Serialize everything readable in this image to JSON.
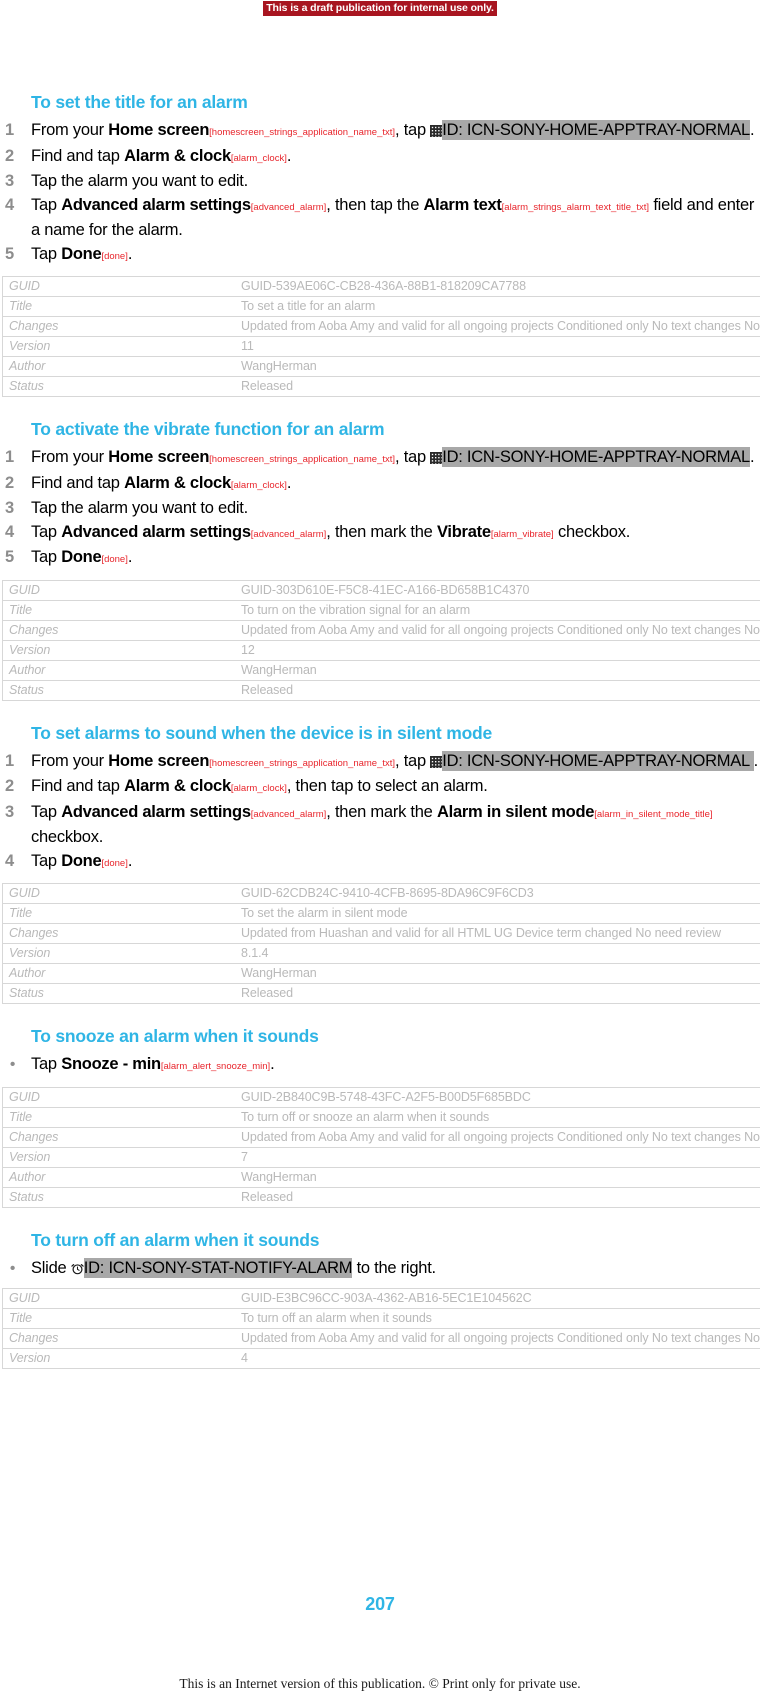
{
  "banner": {
    "draft_notice": "This is a draft publication for internal use only."
  },
  "colors": {
    "heading": "#2fb5e5",
    "string_id": "#e8252c",
    "highlight": "#a8a8a8",
    "banner_bg": "#a81520",
    "table_text": "#b9b9b9",
    "step_number": "#8d8d8d"
  },
  "table_labels": {
    "guid": "GUID",
    "title": "Title",
    "changes": "Changes",
    "version": "Version",
    "author": "Author",
    "status": "Status"
  },
  "icons": {
    "apptray": {
      "name": "app-tray-icon",
      "id_text": "ID: ICN-SONY-HOME-APPTRAY-NORMAL"
    },
    "alarm": {
      "name": "alarm-clock-icon",
      "id_text": "ID: ICN-SONY-STAT-NOTIFY-ALARM"
    }
  },
  "sections": [
    {
      "id": "set-title-for-alarm",
      "title": "To set the title for an alarm",
      "list_type": "ordered",
      "steps": [
        {
          "marker": "1",
          "parts": [
            {
              "t": "text",
              "v": "From your "
            },
            {
              "t": "bold",
              "v": "Home screen"
            },
            {
              "t": "sid",
              "v": "[homescreen_strings_application_name_txt]"
            },
            {
              "t": "text",
              "v": ", tap "
            },
            {
              "t": "icon",
              "v": "apptray"
            },
            {
              "t": "hl",
              "v": "ID: ICN-SONY-HOME-APPTRAY-NORMAL"
            },
            {
              "t": "text",
              "v": "."
            }
          ]
        },
        {
          "marker": "2",
          "parts": [
            {
              "t": "text",
              "v": "Find and tap "
            },
            {
              "t": "bold",
              "v": "Alarm & clock"
            },
            {
              "t": "sid",
              "v": "[alarm_clock]"
            },
            {
              "t": "text",
              "v": "."
            }
          ]
        },
        {
          "marker": "3",
          "parts": [
            {
              "t": "text",
              "v": "Tap the alarm you want to edit."
            }
          ]
        },
        {
          "marker": "4",
          "parts": [
            {
              "t": "text",
              "v": "Tap "
            },
            {
              "t": "bold",
              "v": "Advanced alarm settings"
            },
            {
              "t": "sid",
              "v": "[advanced_alarm]"
            },
            {
              "t": "text",
              "v": ", then tap the "
            },
            {
              "t": "bold",
              "v": "Alarm text"
            },
            {
              "t": "sid",
              "v": "[alarm_strings_alarm_text_title_txt]"
            },
            {
              "t": "text",
              "v": " field and enter a name for the alarm."
            }
          ]
        },
        {
          "marker": "5",
          "parts": [
            {
              "t": "text",
              "v": "Tap "
            },
            {
              "t": "bold",
              "v": "Done"
            },
            {
              "t": "sid",
              "v": "[done]"
            },
            {
              "t": "text",
              "v": "."
            }
          ]
        }
      ],
      "meta": {
        "guid": "GUID-539AE06C-CB28-436A-88B1-818209CA7788",
        "title": "To set a title for an alarm",
        "changes": "Updated from Aoba Amy and valid for all ongoing projects Conditioned only No text changes No need review",
        "version": "11",
        "author": "WangHerman",
        "status": "Released"
      }
    },
    {
      "id": "activate-vibrate-function",
      "title": "To activate the vibrate function for an alarm",
      "list_type": "ordered",
      "steps": [
        {
          "marker": "1",
          "parts": [
            {
              "t": "text",
              "v": "From your "
            },
            {
              "t": "bold",
              "v": "Home screen"
            },
            {
              "t": "sid",
              "v": "[homescreen_strings_application_name_txt]"
            },
            {
              "t": "text",
              "v": ", tap "
            },
            {
              "t": "icon",
              "v": "apptray"
            },
            {
              "t": "hl",
              "v": "ID: ICN-SONY-HOME-APPTRAY-NORMAL"
            },
            {
              "t": "text",
              "v": "."
            }
          ]
        },
        {
          "marker": "2",
          "parts": [
            {
              "t": "text",
              "v": "Find and tap "
            },
            {
              "t": "bold",
              "v": "Alarm & clock"
            },
            {
              "t": "sid",
              "v": "[alarm_clock]"
            },
            {
              "t": "text",
              "v": "."
            }
          ]
        },
        {
          "marker": "3",
          "parts": [
            {
              "t": "text",
              "v": "Tap the alarm you want to edit."
            }
          ]
        },
        {
          "marker": "4",
          "parts": [
            {
              "t": "text",
              "v": "Tap "
            },
            {
              "t": "bold",
              "v": "Advanced alarm settings"
            },
            {
              "t": "sid",
              "v": "[advanced_alarm]"
            },
            {
              "t": "text",
              "v": ", then mark the "
            },
            {
              "t": "bold",
              "v": "Vibrate"
            },
            {
              "t": "sid",
              "v": "[alarm_vibrate]"
            },
            {
              "t": "text",
              "v": " checkbox."
            }
          ]
        },
        {
          "marker": "5",
          "parts": [
            {
              "t": "text",
              "v": "Tap "
            },
            {
              "t": "bold",
              "v": "Done"
            },
            {
              "t": "sid",
              "v": "[done]"
            },
            {
              "t": "text",
              "v": "."
            }
          ]
        }
      ],
      "meta": {
        "guid": "GUID-303D610E-F5C8-41EC-A166-BD658B1C4370",
        "title": "To turn on the vibration signal for an alarm",
        "changes": "Updated from Aoba Amy and valid for all ongoing projects Conditioned only No text changes No need review",
        "version": "12",
        "author": "WangHerman",
        "status": "Released"
      }
    },
    {
      "id": "alarms-in-silent-mode",
      "title": "To set alarms to sound when the device is in silent mode",
      "list_type": "ordered",
      "steps": [
        {
          "marker": "1",
          "parts": [
            {
              "t": "text",
              "v": "From your "
            },
            {
              "t": "bold",
              "v": "Home screen"
            },
            {
              "t": "sid",
              "v": "[homescreen_strings_application_name_txt]"
            },
            {
              "t": "text",
              "v": ", tap "
            },
            {
              "t": "icon",
              "v": "apptray"
            },
            {
              "t": "hl",
              "v": "ID: ICN-SONY-HOME-APPTRAY-NORMAL "
            },
            {
              "t": "text",
              "v": "."
            }
          ]
        },
        {
          "marker": "2",
          "parts": [
            {
              "t": "text",
              "v": "Find and tap "
            },
            {
              "t": "bold",
              "v": "Alarm & clock"
            },
            {
              "t": "sid",
              "v": "[alarm_clock]"
            },
            {
              "t": "text",
              "v": ", then tap to select an alarm."
            }
          ]
        },
        {
          "marker": "3",
          "parts": [
            {
              "t": "text",
              "v": "Tap "
            },
            {
              "t": "bold",
              "v": "Advanced alarm settings"
            },
            {
              "t": "sid",
              "v": "[advanced_alarm]"
            },
            {
              "t": "text",
              "v": ", then mark the "
            },
            {
              "t": "bold",
              "v": "Alarm in silent mode"
            },
            {
              "t": "sid",
              "v": "[alarm_in_silent_mode_title]"
            },
            {
              "t": "text",
              "v": " checkbox."
            }
          ]
        },
        {
          "marker": "4",
          "parts": [
            {
              "t": "text",
              "v": "Tap "
            },
            {
              "t": "bold",
              "v": "Done"
            },
            {
              "t": "sid",
              "v": "[done]"
            },
            {
              "t": "text",
              "v": "."
            }
          ]
        }
      ],
      "meta": {
        "guid": "GUID-62CDB24C-9410-4CFB-8695-8DA96C9F6CD3",
        "title": "To set the alarm in silent mode",
        "changes": "Updated from Huashan and valid for all HTML UG Device term changed No need review",
        "version": "8.1.4",
        "author": "WangHerman",
        "status": "Released"
      }
    },
    {
      "id": "snooze-alarm",
      "title": "To snooze an alarm when it sounds",
      "list_type": "bullet",
      "steps": [
        {
          "marker": "•",
          "parts": [
            {
              "t": "text",
              "v": "Tap "
            },
            {
              "t": "bold",
              "v": "Snooze - min"
            },
            {
              "t": "sid",
              "v": "[alarm_alert_snooze_min]"
            },
            {
              "t": "text",
              "v": "."
            }
          ]
        }
      ],
      "meta": {
        "guid": "GUID-2B840C9B-5748-43FC-A2F5-B00D5F685BDC",
        "title": "To turn off or snooze an alarm when it sounds",
        "changes": "Updated from Aoba Amy and valid for all ongoing projects Conditioned only No text changes No need review",
        "version": "7",
        "author": "WangHerman",
        "status": "Released"
      }
    },
    {
      "id": "turn-off-alarm",
      "title": "To turn off an alarm when it sounds",
      "list_type": "bullet",
      "steps": [
        {
          "marker": "•",
          "parts": [
            {
              "t": "text",
              "v": "Slide "
            },
            {
              "t": "icon",
              "v": "alarm"
            },
            {
              "t": "hl",
              "v": "ID: ICN-SONY-STAT-NOTIFY-ALARM"
            },
            {
              "t": "text",
              "v": " to the right."
            }
          ]
        }
      ],
      "meta": {
        "guid": "GUID-E3BC96CC-903A-4362-AB16-5EC1E104562C",
        "title": "To turn off an alarm when it sounds",
        "changes": "Updated from Aoba Amy and valid for all ongoing projects Conditioned only No text changes No need review",
        "version": "4"
      }
    }
  ],
  "footer": {
    "page_number": "207",
    "notice": "This is an Internet version of this publication. © Print only for private use."
  }
}
